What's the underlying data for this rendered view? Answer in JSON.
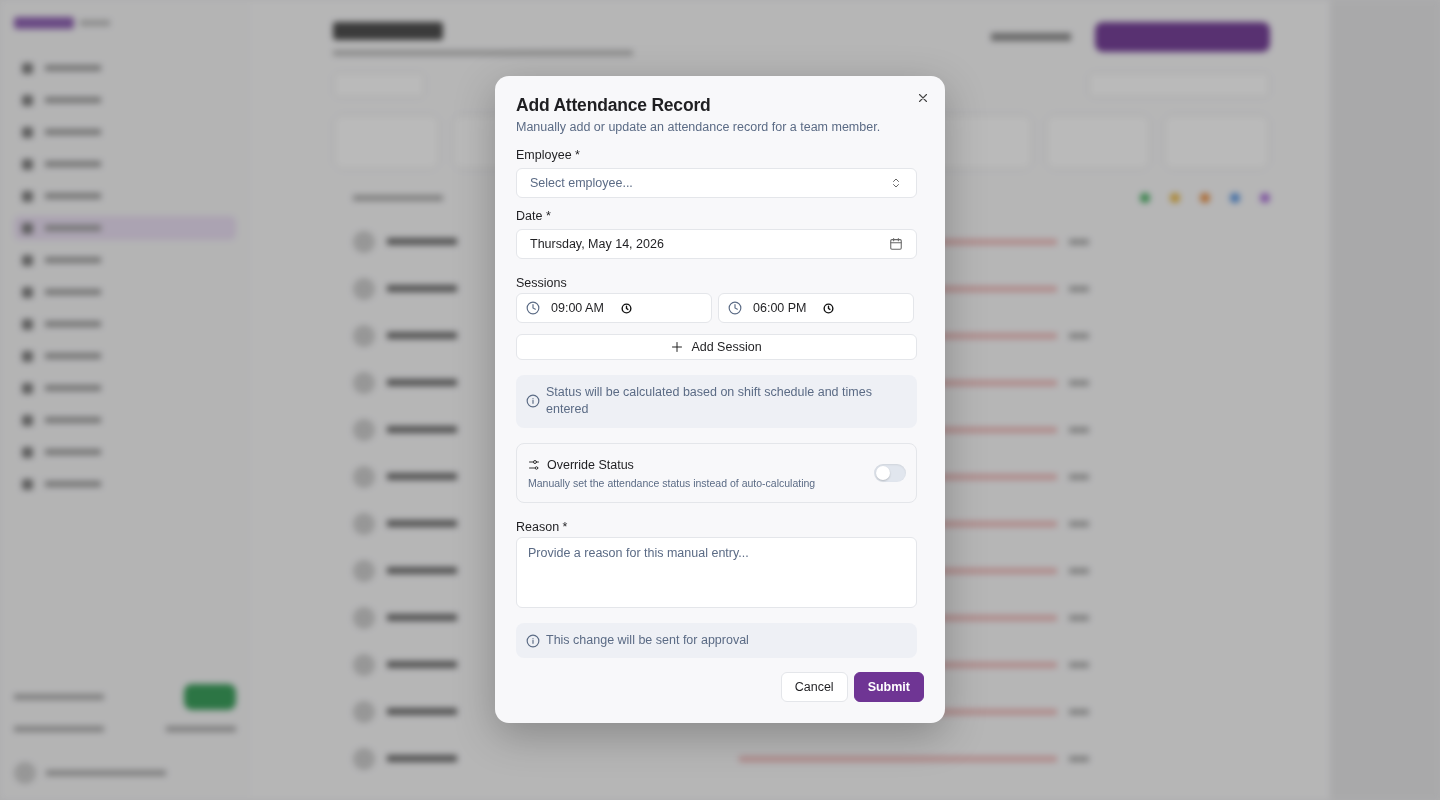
{
  "dialog": {
    "title": "Add Attendance Record",
    "description": "Manually add or update an attendance record for a team member.",
    "employee": {
      "label": "Employee *",
      "placeholder": "Select employee..."
    },
    "date": {
      "label": "Date *",
      "value": "Thursday, May 14, 2026"
    },
    "sessions": {
      "label": "Sessions",
      "rows": [
        {
          "start": "09:00 AM",
          "end": "06:00 PM"
        }
      ],
      "add_button": "Add Session"
    },
    "status_note": "Status will be calculated based on shift schedule and times entered",
    "override": {
      "title": "Override Status",
      "description": "Manually set the attendance status instead of auto-calculating",
      "on": false
    },
    "reason": {
      "label": "Reason *",
      "placeholder": "Provide a reason for this manual entry..."
    },
    "approval_note": "This change will be sent for approval",
    "buttons": [
      {
        "label": "Cancel",
        "kind": "secondary"
      },
      {
        "label": "Submit",
        "kind": "primary"
      }
    ]
  }
}
